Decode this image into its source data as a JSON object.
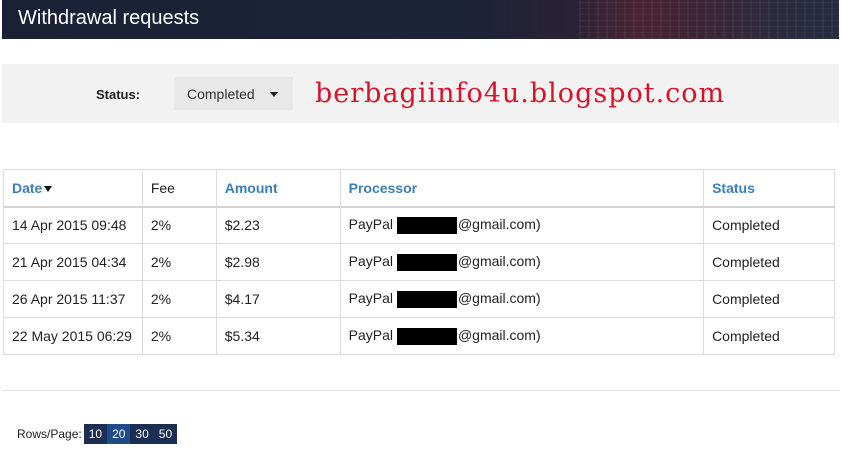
{
  "header": {
    "title": "Withdrawal requests"
  },
  "filter": {
    "status_label": "Status:",
    "status_value": "Completed",
    "watermark": "berbagiinfo4u.blogspot.com"
  },
  "table": {
    "columns": [
      "Date",
      "Fee",
      "Amount",
      "Processor",
      "Status"
    ],
    "rows": [
      {
        "date": "14 Apr 2015 09:48",
        "fee": "2%",
        "amount": "$2.23",
        "processor_prefix": "PayPal",
        "processor_suffix": "@gmail.com)",
        "status": "Completed"
      },
      {
        "date": "21 Apr 2015 04:34",
        "fee": "2%",
        "amount": "$2.98",
        "processor_prefix": "PayPal",
        "processor_suffix": "@gmail.com)",
        "status": "Completed"
      },
      {
        "date": "26 Apr 2015 11:37",
        "fee": "2%",
        "amount": "$4.17",
        "processor_prefix": "PayPal",
        "processor_suffix": "@gmail.com)",
        "status": "Completed"
      },
      {
        "date": "22 May 2015 06:29",
        "fee": "2%",
        "amount": "$5.34",
        "processor_prefix": "PayPal",
        "processor_suffix": "@gmail.com)",
        "status": "Completed"
      }
    ]
  },
  "pager": {
    "label": "Rows/Page:",
    "options": [
      "10",
      "20",
      "30",
      "50"
    ],
    "selected": "20"
  },
  "colors": {
    "header_bg": "#1b2135",
    "link": "#3a80b8",
    "watermark": "#d8122a",
    "pager_bg": "#1c2f52",
    "pager_active": "#1f4b86"
  }
}
